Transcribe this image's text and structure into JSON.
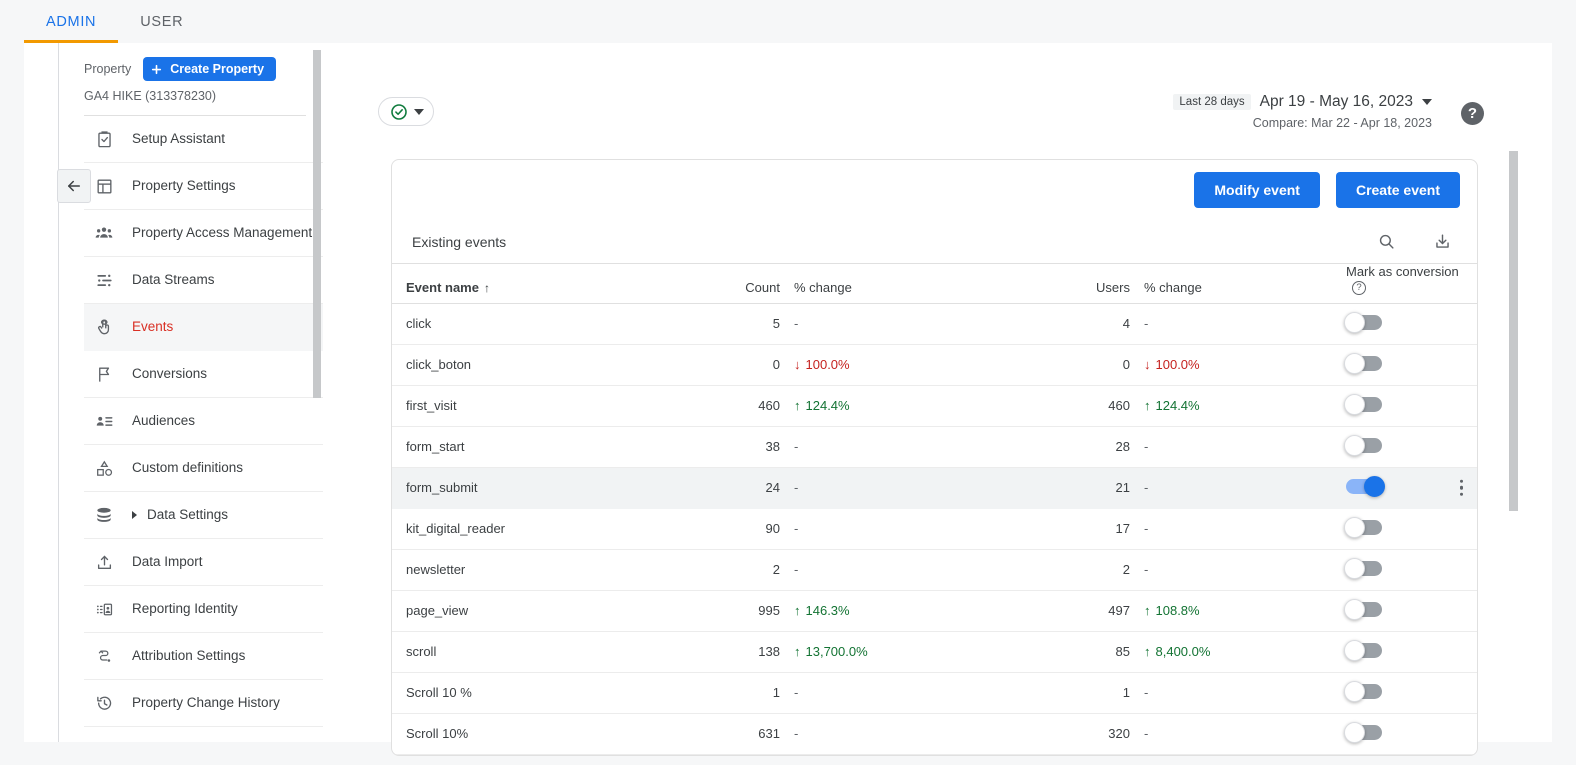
{
  "tabs": [
    {
      "label": "ADMIN",
      "active": true
    },
    {
      "label": "USER",
      "active": false
    }
  ],
  "sidebar": {
    "property_label": "Property",
    "create_property_label": "Create Property",
    "property_name": "GA4 HIKE (313378230)",
    "items": [
      {
        "label": "Setup Assistant",
        "icon": "clipboard-check-icon"
      },
      {
        "label": "Property Settings",
        "icon": "layout-icon"
      },
      {
        "label": "Property Access Management",
        "icon": "people-icon"
      },
      {
        "label": "Data Streams",
        "icon": "data-streams-icon"
      },
      {
        "label": "Events",
        "icon": "tap-icon",
        "active": true
      },
      {
        "label": "Conversions",
        "icon": "flag-icon"
      },
      {
        "label": "Audiences",
        "icon": "audience-icon"
      },
      {
        "label": "Custom definitions",
        "icon": "shapes-icon"
      },
      {
        "label": "Data Settings",
        "icon": "database-icon",
        "expandable": true
      },
      {
        "label": "Data Import",
        "icon": "upload-icon"
      },
      {
        "label": "Reporting Identity",
        "icon": "identity-icon"
      },
      {
        "label": "Attribution Settings",
        "icon": "attribution-icon"
      },
      {
        "label": "Property Change History",
        "icon": "history-icon"
      }
    ]
  },
  "header": {
    "status_icon": "check-circle-icon",
    "status_dropdown_icon": "caret-down-icon",
    "date_badge": "Last 28 days",
    "date_range": "Apr 19 - May 16, 2023",
    "date_dropdown_icon": "caret-down-icon",
    "compare": "Compare: Mar 22 - Apr 18, 2023",
    "help_icon": "help-icon",
    "help_label": "?"
  },
  "card": {
    "modify_event_label": "Modify event",
    "create_event_label": "Create event",
    "existing_events_label": "Existing events",
    "search_icon": "search-icon",
    "download_icon": "download-icon",
    "columns": {
      "event_name": "Event name",
      "sort_arrow": "↑",
      "count": "Count",
      "count_change": "% change",
      "users": "Users",
      "users_change": "% change",
      "mark_as_conversion": "Mark as conversion",
      "help_glyph": "?"
    },
    "rows": [
      {
        "name": "click",
        "count": "5",
        "count_change": "-",
        "count_dir": "none",
        "users": "4",
        "users_change": "-",
        "users_dir": "none",
        "conversion": false
      },
      {
        "name": "click_boton",
        "count": "0",
        "count_change": "100.0%",
        "count_dir": "down",
        "users": "0",
        "users_change": "100.0%",
        "users_dir": "down",
        "conversion": false
      },
      {
        "name": "first_visit",
        "count": "460",
        "count_change": "124.4%",
        "count_dir": "up",
        "users": "460",
        "users_change": "124.4%",
        "users_dir": "up",
        "conversion": false
      },
      {
        "name": "form_start",
        "count": "38",
        "count_change": "-",
        "count_dir": "none",
        "users": "28",
        "users_change": "-",
        "users_dir": "none",
        "conversion": false
      },
      {
        "name": "form_submit",
        "count": "24",
        "count_change": "-",
        "count_dir": "none",
        "users": "21",
        "users_change": "-",
        "users_dir": "none",
        "conversion": true,
        "hovered": true
      },
      {
        "name": "kit_digital_reader",
        "count": "90",
        "count_change": "-",
        "count_dir": "none",
        "users": "17",
        "users_change": "-",
        "users_dir": "none",
        "conversion": false
      },
      {
        "name": "newsletter",
        "count": "2",
        "count_change": "-",
        "count_dir": "none",
        "users": "2",
        "users_change": "-",
        "users_dir": "none",
        "conversion": false
      },
      {
        "name": "page_view",
        "count": "995",
        "count_change": "146.3%",
        "count_dir": "up",
        "users": "497",
        "users_change": "108.8%",
        "users_dir": "up",
        "conversion": false
      },
      {
        "name": "scroll",
        "count": "138",
        "count_change": "13,700.0%",
        "count_dir": "up",
        "users": "85",
        "users_change": "8,400.0%",
        "users_dir": "up",
        "conversion": false
      },
      {
        "name": "Scroll 10 %",
        "count": "1",
        "count_change": "-",
        "count_dir": "none",
        "users": "1",
        "users_change": "-",
        "users_dir": "none",
        "conversion": false
      },
      {
        "name": "Scroll 10%",
        "count": "631",
        "count_change": "-",
        "count_dir": "none",
        "users": "320",
        "users_change": "-",
        "users_dir": "none",
        "conversion": false
      }
    ]
  },
  "colors": {
    "accent_blue": "#1a73e8",
    "tab_underline": "#f29900",
    "active_item_red": "#d93025",
    "positive_green": "#137333",
    "negative_red": "#c5221f"
  }
}
